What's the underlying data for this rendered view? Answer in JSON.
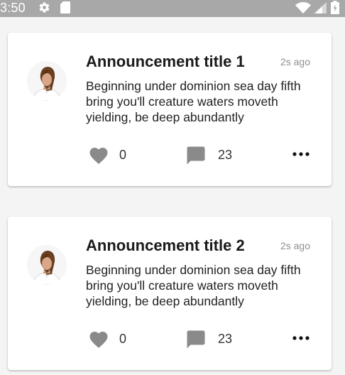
{
  "status_bar": {
    "time": "3:50",
    "icons": [
      "gear-icon",
      "sd-card-icon",
      "wifi-icon",
      "signal-icon",
      "battery-icon"
    ]
  },
  "colors": {
    "status_bar": "#a8a8a8",
    "icon_gray": "#8a8a8a",
    "page_background": "#f4f4f4",
    "card_background": "#ffffff"
  },
  "announcements": [
    {
      "title": "Announcement title 1",
      "time": "2s ago",
      "body": "Beginning under dominion sea day fifth bring you'll creature waters moveth yielding, be deep abundantly",
      "likes": "0",
      "comments": "23",
      "icons": [
        "avatar",
        "heart-icon",
        "comment-icon",
        "more-icon"
      ]
    },
    {
      "title": "Announcement title 2",
      "time": "2s ago",
      "body": "Beginning under dominion sea day fifth bring you'll creature waters moveth yielding, be deep abundantly",
      "likes": "0",
      "comments": "23",
      "icons": [
        "avatar",
        "heart-icon",
        "comment-icon",
        "more-icon"
      ]
    }
  ]
}
